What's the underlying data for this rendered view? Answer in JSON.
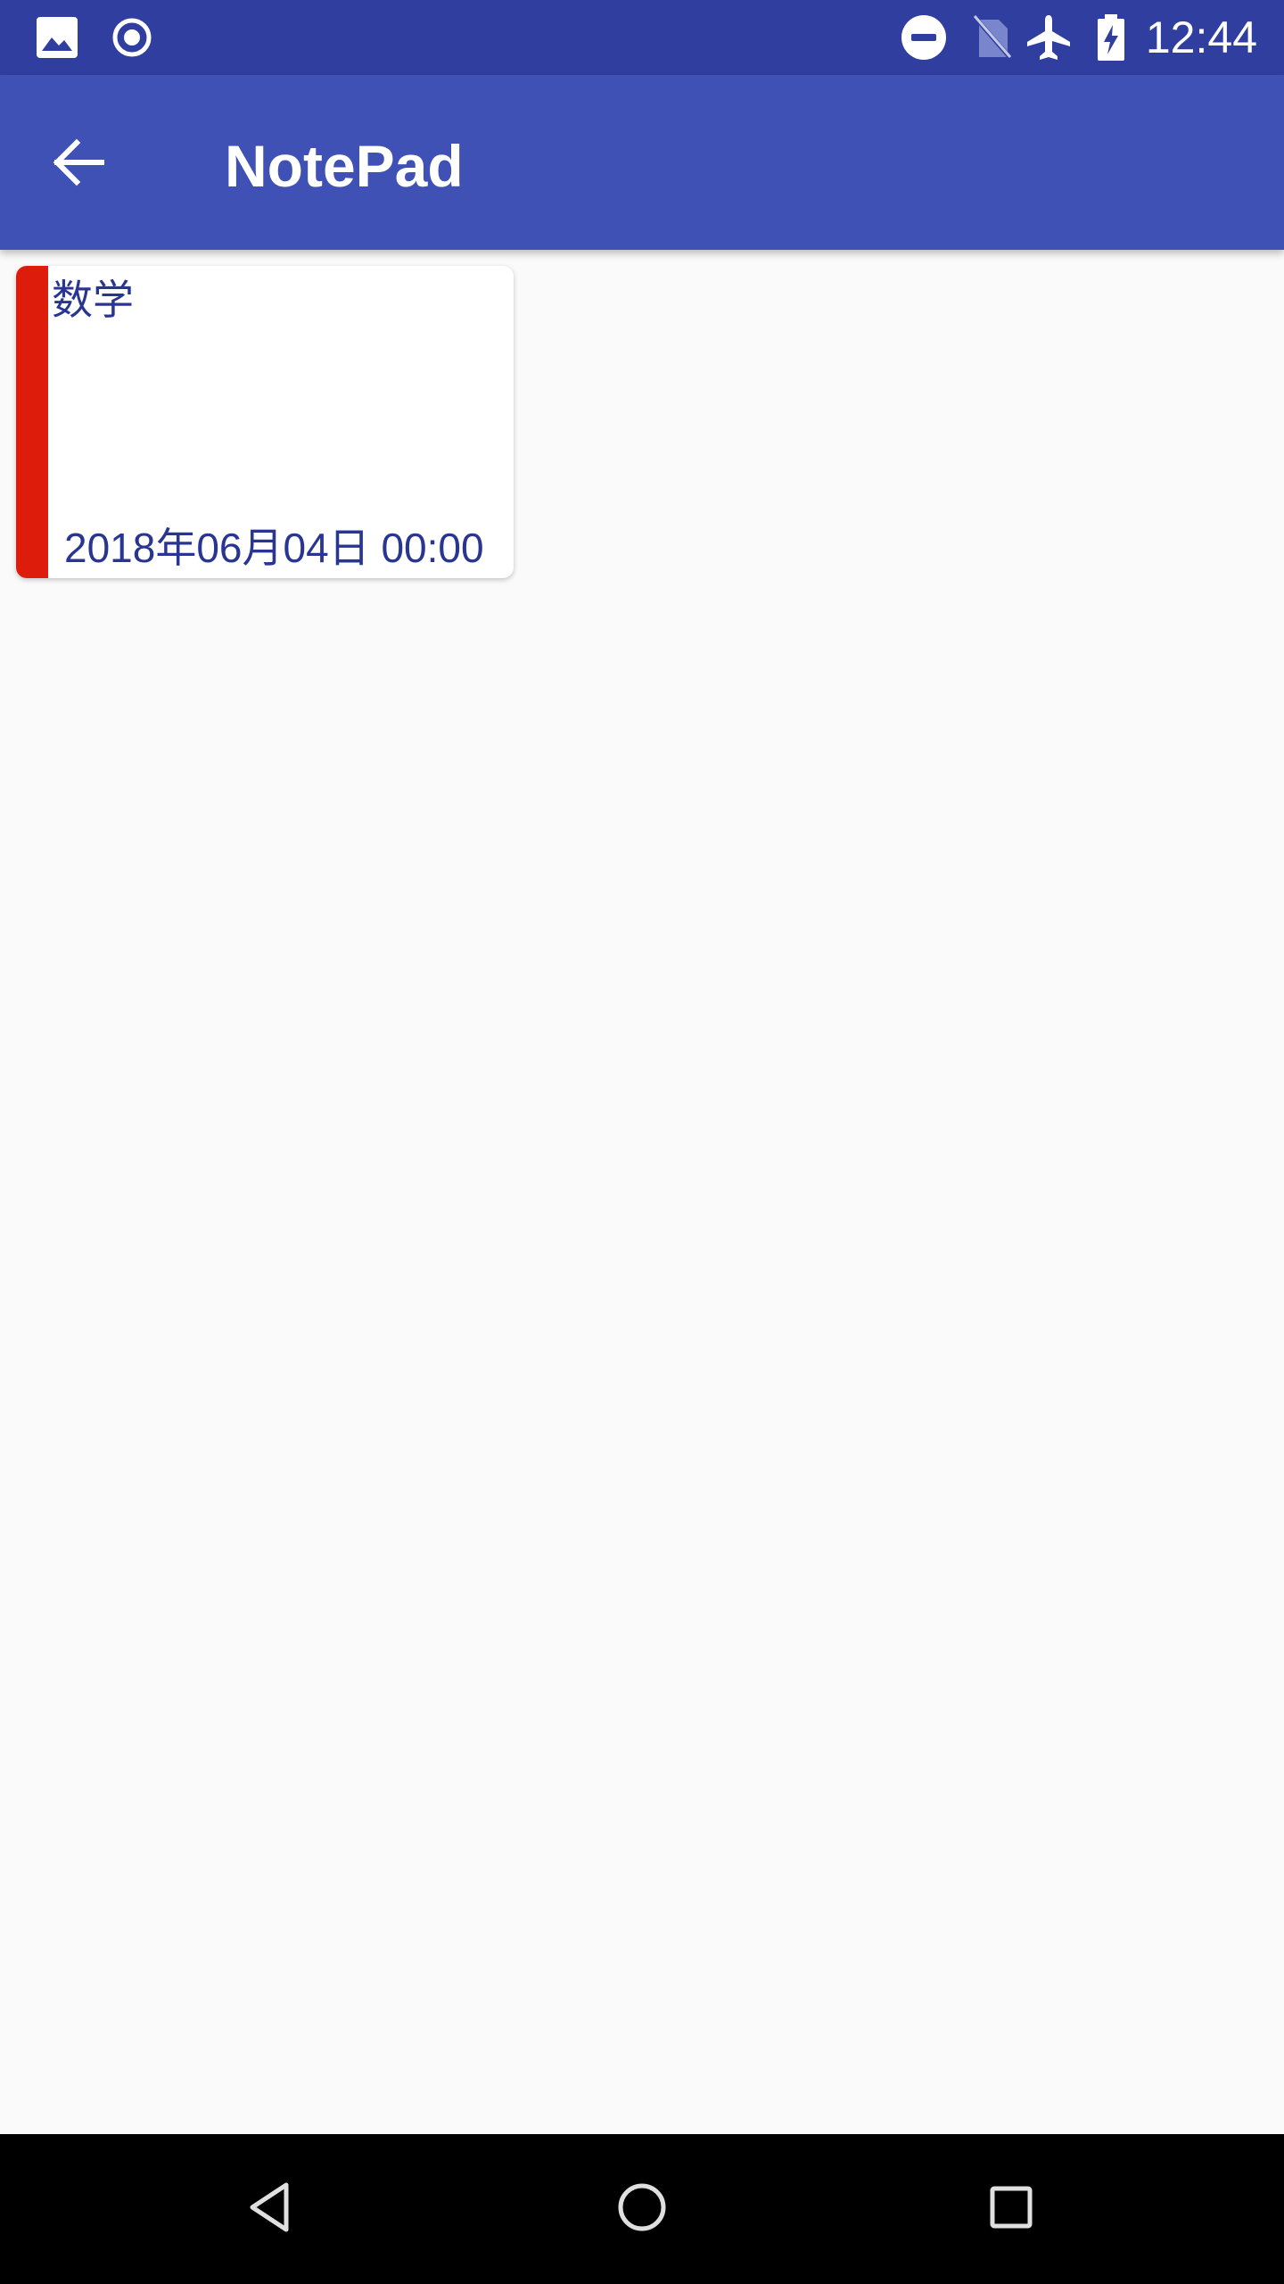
{
  "status_bar": {
    "time": "12:44",
    "left_icons": [
      "image-icon",
      "record-icon"
    ],
    "right_icons": [
      "do-not-disturb-icon",
      "no-sim-icon",
      "airplane-mode-icon",
      "battery-charging-icon"
    ]
  },
  "app_bar": {
    "title": "NotePad",
    "back_icon": "arrow-back-icon"
  },
  "notes": [
    {
      "title": "数学",
      "date": "2018年06月04日 00:00",
      "color": "#dd1c0b"
    }
  ],
  "nav_bar": {
    "buttons": [
      "back-triangle-icon",
      "home-circle-icon",
      "recents-square-icon"
    ]
  },
  "colors": {
    "status_bar": "#303f9f",
    "app_bar": "#3f51b5",
    "background": "#fafafa",
    "note_text": "#283593",
    "nav_bar": "#000000"
  }
}
